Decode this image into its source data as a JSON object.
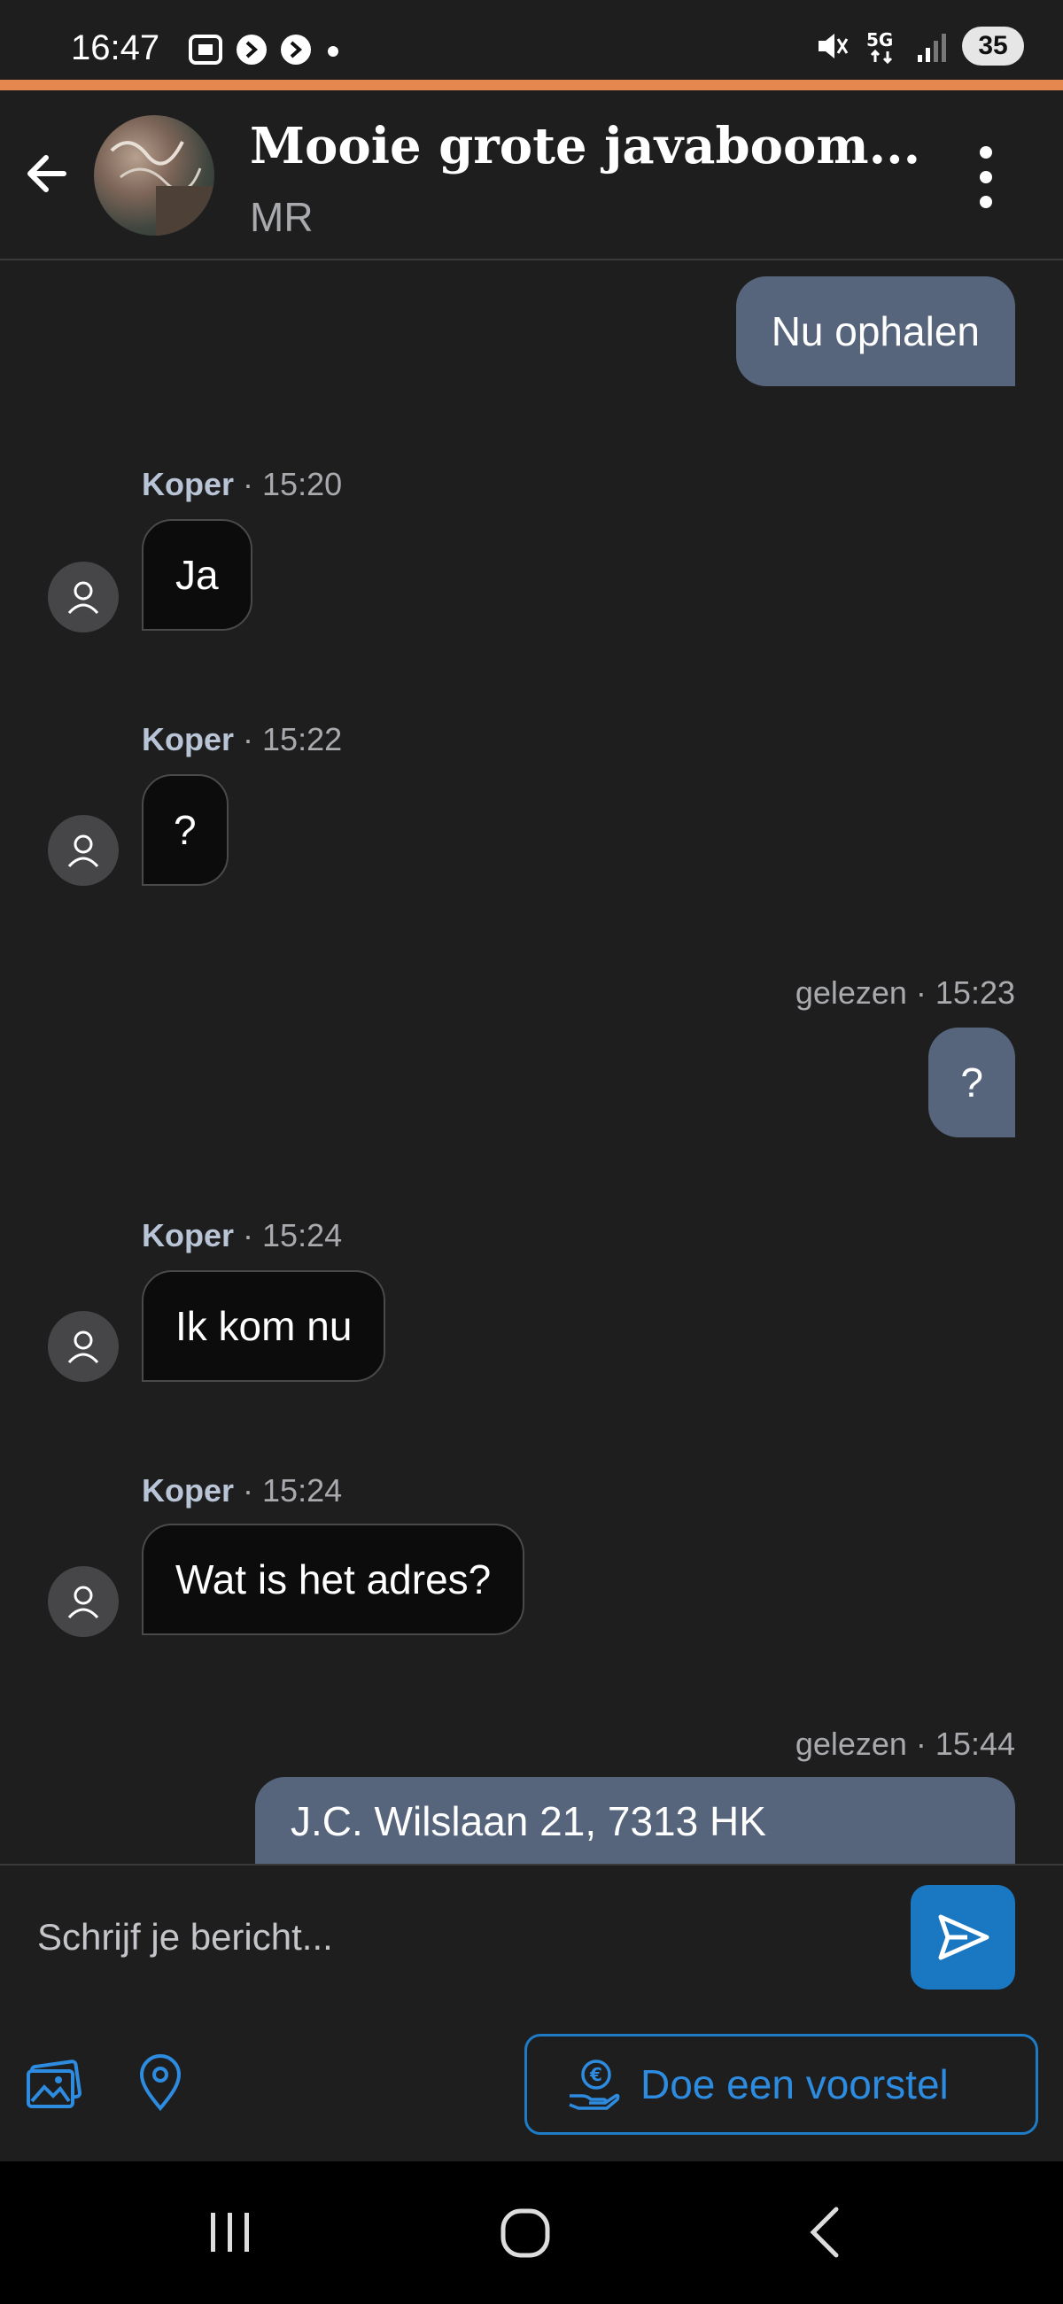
{
  "status_bar": {
    "time": "16:47",
    "battery": "35",
    "network": "5G"
  },
  "header": {
    "title": "Mooie grote javaboom...",
    "subtitle": "MR"
  },
  "messages": [
    {
      "direction": "out",
      "text": "Nu ophalen"
    },
    {
      "direction": "in",
      "sender": "Koper",
      "time": "· 15:20",
      "text": "Ja"
    },
    {
      "direction": "in",
      "sender": "Koper",
      "time": "· 15:22",
      "text": "?"
    },
    {
      "direction": "out",
      "meta": "gelezen · 15:23",
      "text": "?"
    },
    {
      "direction": "in",
      "sender": "Koper",
      "time": "· 15:24",
      "text": "Ik kom nu"
    },
    {
      "direction": "in",
      "sender": "Koper",
      "time": "· 15:24",
      "text": "Wat is het adres?"
    },
    {
      "direction": "out",
      "meta": "gelezen · 15:44",
      "text": "J.C. Wilslaan 21, 7313 HK"
    }
  ],
  "composer": {
    "placeholder": "Schrijf je bericht..."
  },
  "actions": {
    "offer_label": "Doe een voorstel"
  },
  "colors": {
    "accent": "#e5884f",
    "outgoing_bubble": "#56657c",
    "primary": "#1a78c2"
  }
}
